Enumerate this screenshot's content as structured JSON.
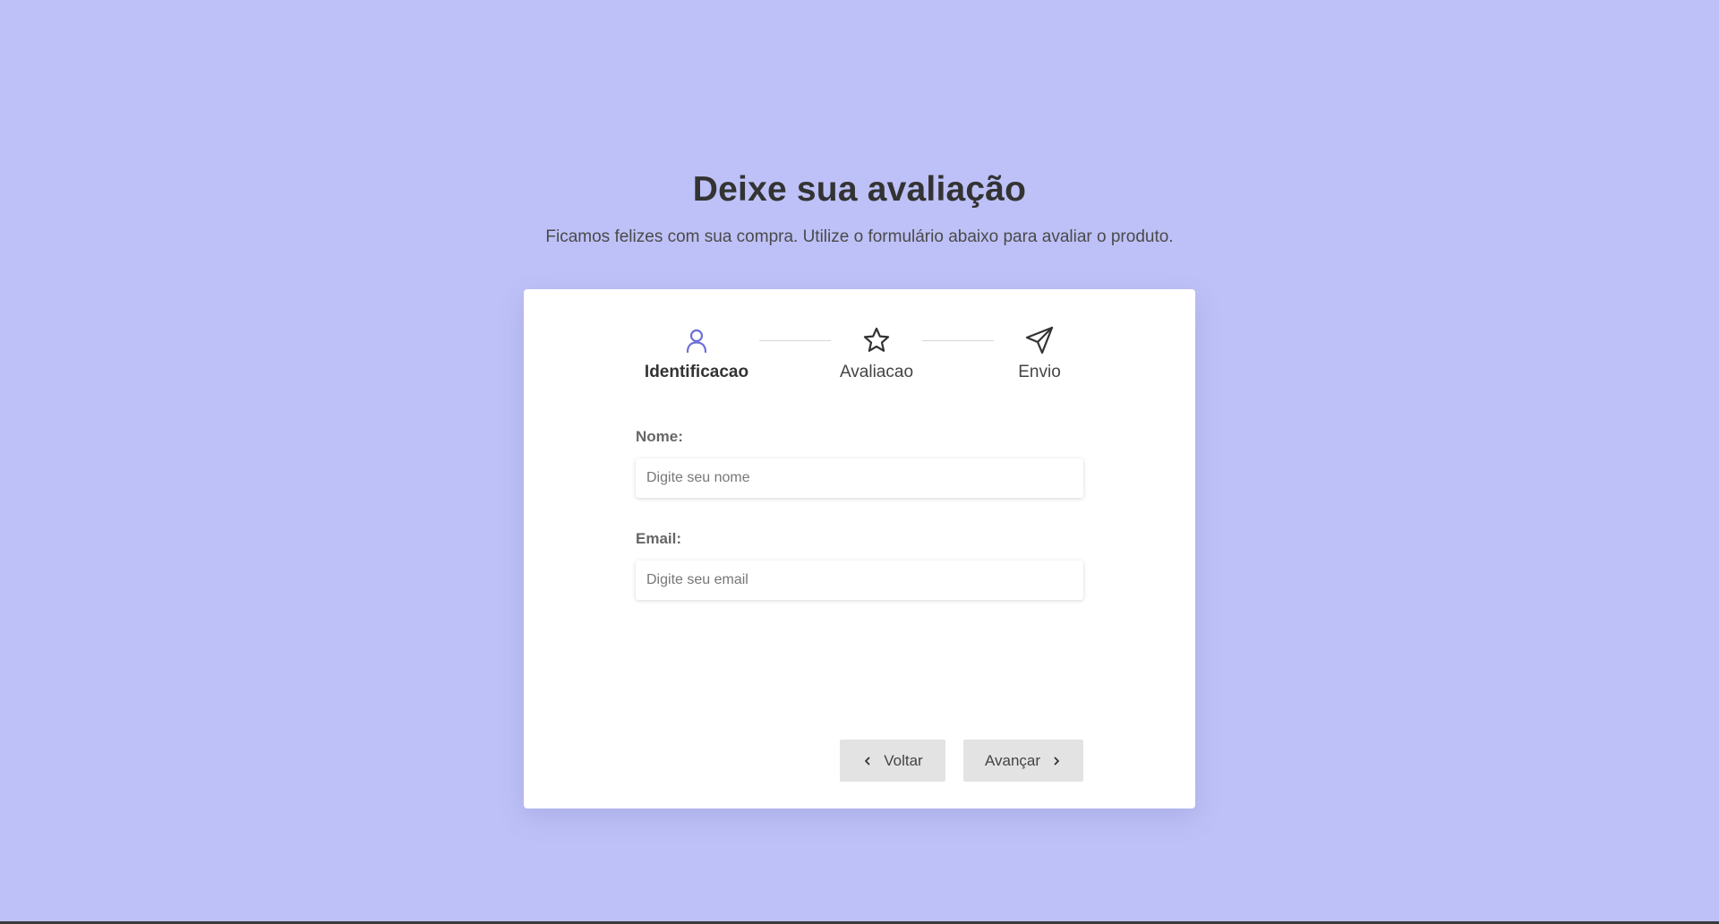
{
  "page": {
    "title": "Deixe sua avaliação",
    "subtitle": "Ficamos felizes com sua compra. Utilize o formulário abaixo para avaliar o produto."
  },
  "stepper": {
    "steps": [
      {
        "label": "Identificacao",
        "icon": "user-icon",
        "active": true
      },
      {
        "label": "Avaliacao",
        "icon": "star-icon",
        "active": false
      },
      {
        "label": "Envio",
        "icon": "send-icon",
        "active": false
      }
    ]
  },
  "form": {
    "name": {
      "label": "Nome:",
      "placeholder": "Digite seu nome",
      "value": ""
    },
    "email": {
      "label": "Email:",
      "placeholder": "Digite seu email",
      "value": ""
    }
  },
  "actions": {
    "back_label": "Voltar",
    "next_label": "Avançar"
  },
  "colors": {
    "background": "#bec1f7",
    "accent": "#6d6fd8",
    "text": "#333333",
    "button_bg": "#e3e3e3"
  }
}
